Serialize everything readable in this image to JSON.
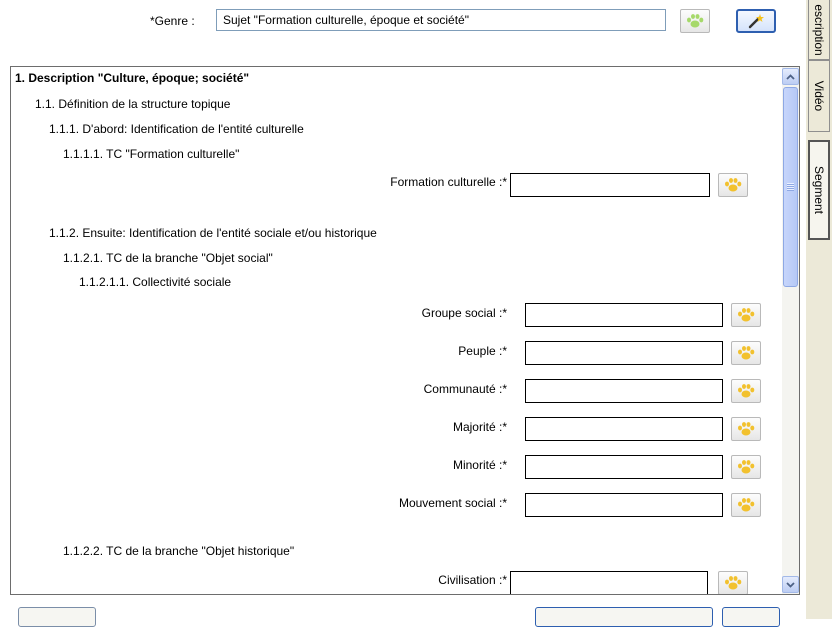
{
  "header": {
    "genre_label": "*Genre :",
    "genre_value": "Sujet \"Formation culturelle, époque et société\""
  },
  "side_tabs": [
    "escription",
    "Vidéo",
    "Segment"
  ],
  "panel": {
    "title": "1. Description \"Culture, époque; société\"",
    "lines": {
      "l1": "1.1. Définition de la structure topique",
      "l2": "1.1.1. D'abord: Identification de l'entité culturelle",
      "l3": "1.1.1.1. TC \"Formation culturelle\"",
      "l4": "1.1.2. Ensuite: Identification de l'entité sociale et/ou historique",
      "l5": "1.1.2.1. TC de la branche \"Objet social\"",
      "l6": "1.1.2.1.1. Collectivité sociale",
      "l7": "1.1.2.2. TC de la branche \"Objet historique\""
    },
    "fields": {
      "formation": "Formation culturelle :*",
      "groupe": "Groupe social :*",
      "peuple": "Peuple :*",
      "communaute": "Communauté :*",
      "majorite": "Majorité :*",
      "minorite": "Minorité :*",
      "mouvement": "Mouvement social :*",
      "civilisation": "Civilisation :*"
    }
  },
  "icons": {
    "paw": "paw-print-icon",
    "wand": "magic-wand-icon",
    "scroll_up": "scroll-up-arrow-icon",
    "scroll_down": "scroll-down-arrow-icon"
  },
  "colors": {
    "paw_yellow": "#f2c12e",
    "scroll_blue": "#bccdf3",
    "tab_bg": "#ece9d8"
  }
}
